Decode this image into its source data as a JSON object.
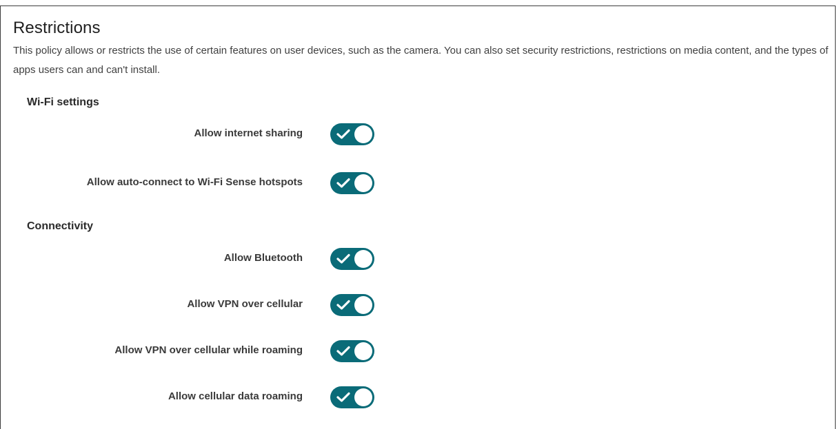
{
  "page": {
    "title": "Restrictions",
    "description": "This policy allows or restricts the use of certain features on user devices, such as the camera. You can also set security restrictions, restrictions on media content, and the types of apps users can and can't install."
  },
  "sections": [
    {
      "title": "Wi-Fi settings",
      "settings": [
        {
          "label": "Allow internet sharing",
          "enabled": true
        },
        {
          "label": "Allow auto-connect to Wi-Fi Sense hotspots",
          "enabled": true
        }
      ]
    },
    {
      "title": "Connectivity",
      "settings": [
        {
          "label": "Allow Bluetooth",
          "enabled": true
        },
        {
          "label": "Allow VPN over cellular",
          "enabled": true
        },
        {
          "label": "Allow VPN over cellular while roaming",
          "enabled": true
        },
        {
          "label": "Allow cellular data roaming",
          "enabled": true
        }
      ]
    }
  ],
  "colors": {
    "toggle_on": "#0a6b78",
    "knob": "#ffffff"
  },
  "icons": {
    "toggle_on": "check-icon"
  }
}
